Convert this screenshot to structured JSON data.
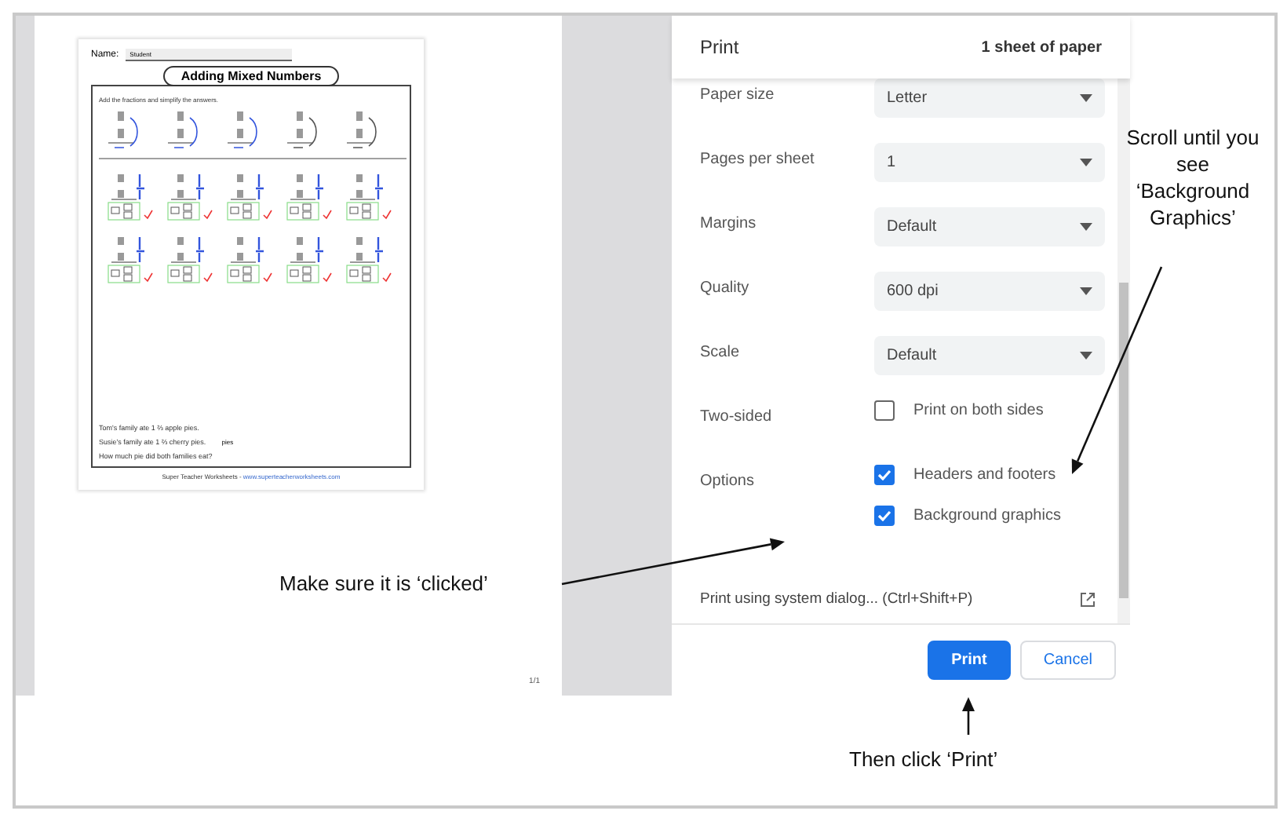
{
  "preview": {
    "name_label": "Name:",
    "name_value": "Student",
    "title": "Adding Mixed Numbers",
    "instructions": "Add the fractions and simplify the answers.",
    "word_problem": [
      "Tom's family ate 1 ⅔ apple pies.",
      "Susie's family ate 1 ⅔ cherry pies.",
      "How much pie did both families eat?"
    ],
    "answer_unit": "pies",
    "footer": "Super Teacher Worksheets - ",
    "footer_link": "www.superteacherworksheets.com",
    "page_number": "1/1"
  },
  "dialog": {
    "title": "Print",
    "sheets": "1 sheet of paper",
    "rows": [
      {
        "label": "Paper size",
        "kind": "select",
        "value": "Letter"
      },
      {
        "label": "Pages per sheet",
        "kind": "select",
        "value": "1"
      },
      {
        "label": "Margins",
        "kind": "select",
        "value": "Default"
      },
      {
        "label": "Quality",
        "kind": "select",
        "value": "600 dpi"
      },
      {
        "label": "Scale",
        "kind": "select",
        "value": "Default"
      },
      {
        "label": "Two-sided",
        "kind": "checkboxes",
        "options": [
          {
            "label": "Print on both sides",
            "checked": false
          }
        ]
      },
      {
        "label": "Options",
        "kind": "checkboxes",
        "options": [
          {
            "label": "Headers and footers",
            "checked": true
          },
          {
            "label": "Background graphics",
            "checked": true
          }
        ]
      }
    ],
    "system_dialog": "Print using system dialog... (Ctrl+Shift+P)",
    "buttons": [
      {
        "label": "Print",
        "kind": "primary"
      },
      {
        "label": "Cancel",
        "kind": "secondary"
      }
    ]
  },
  "annotations": {
    "scroll": "Scroll until you see ‘Background Graphics’",
    "clicked": "Make sure it is ‘clicked’",
    "print": "Then click ‘Print’"
  }
}
